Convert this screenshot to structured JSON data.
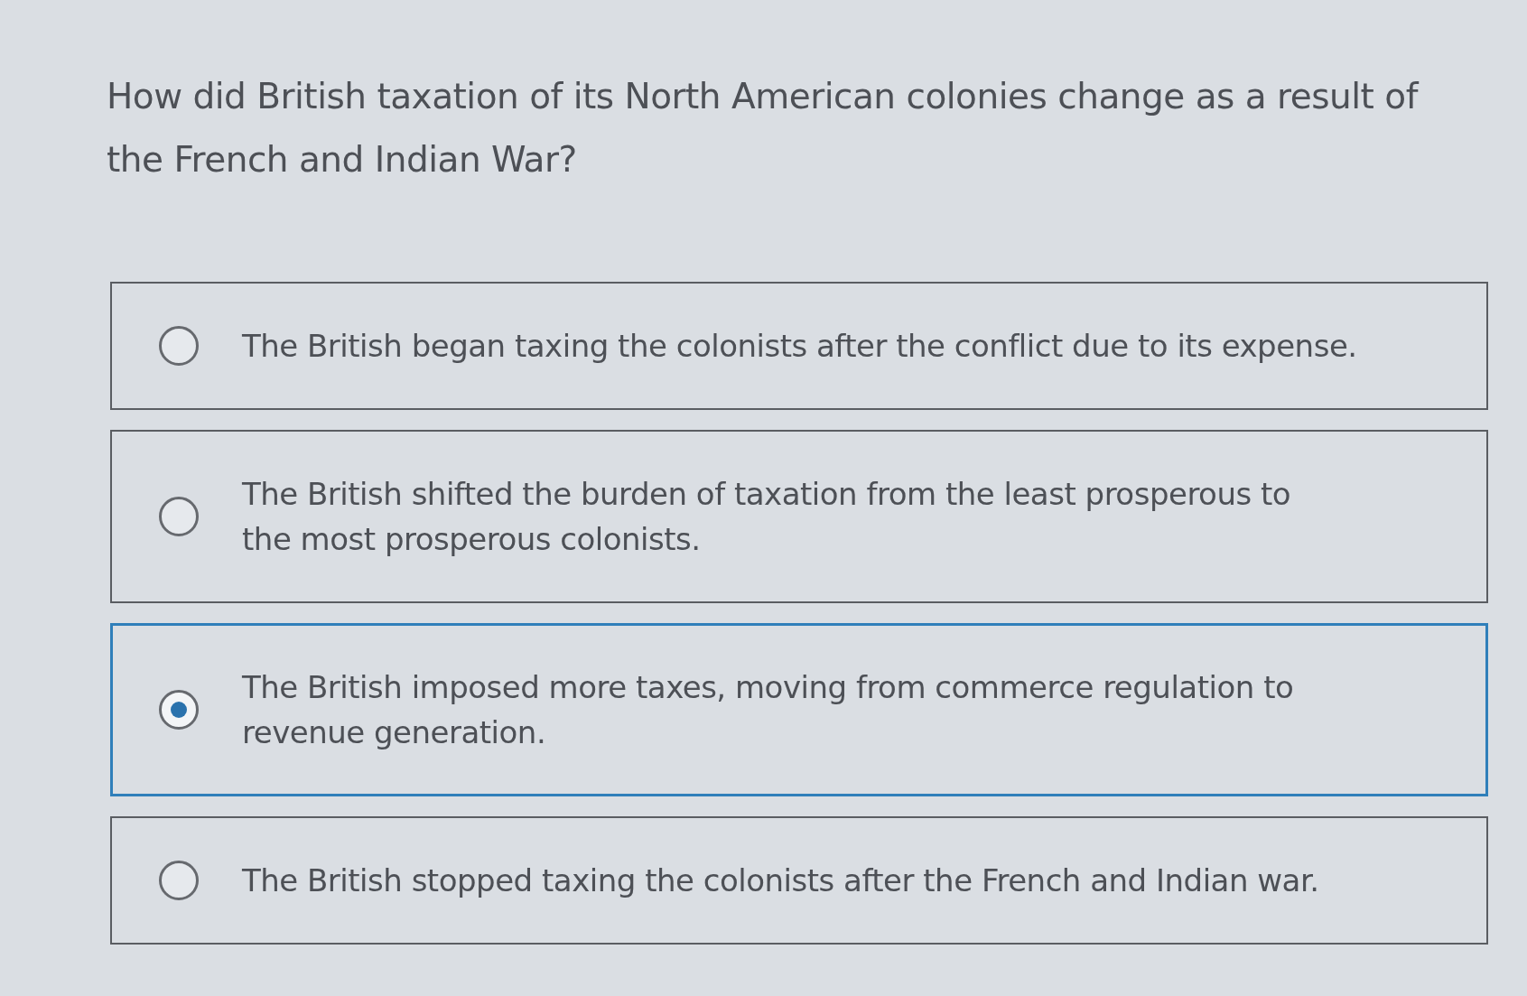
{
  "question": "How did British taxation of its North American colonies change as a result of the French and Indian War?",
  "options": [
    {
      "lines": [
        "The British began taxing the colonists after the conflict due to its expense."
      ],
      "selected": false
    },
    {
      "lines": [
        "The British shifted the burden of taxation from the least prosperous to",
        "the most prosperous colonists."
      ],
      "selected": false
    },
    {
      "lines": [
        "The British imposed more taxes, moving from commerce regulation to",
        "revenue generation."
      ],
      "selected": true
    },
    {
      "lines": [
        "The British stopped taxing the colonists after the French and Indian war."
      ],
      "selected": false
    }
  ]
}
